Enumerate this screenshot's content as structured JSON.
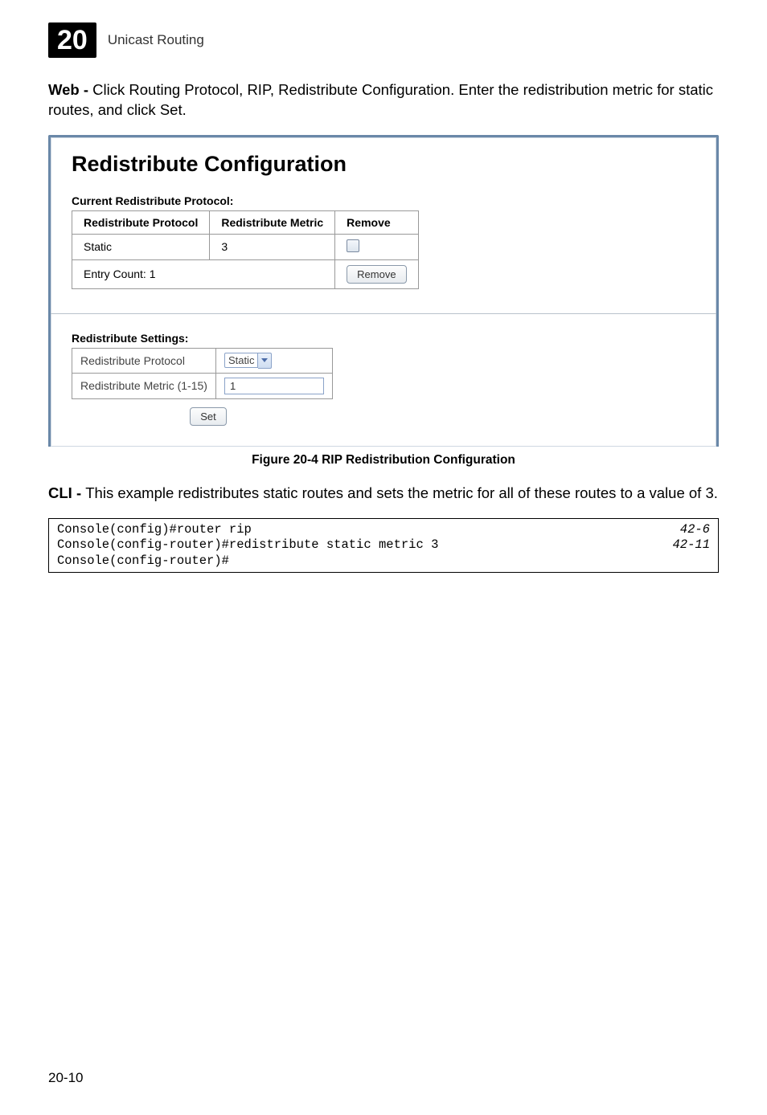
{
  "header": {
    "chapter_number": "20",
    "chapter_title": "Unicast Routing"
  },
  "intro": {
    "lead": "Web - ",
    "text": "Click Routing Protocol, RIP, Redistribute Configuration. Enter the redistribution metric for static routes, and click Set."
  },
  "panel": {
    "title": "Redistribute Configuration",
    "current_protocol_label": "Current Redistribute Protocol:",
    "table": {
      "headers": [
        "Redistribute Protocol",
        "Redistribute Metric",
        "Remove"
      ],
      "rows": [
        {
          "protocol": "Static",
          "metric": "3",
          "remove_checked": false
        }
      ],
      "entry_count_label": "Entry Count: 1",
      "remove_button": "Remove"
    },
    "settings": {
      "heading": "Redistribute Settings:",
      "rows": [
        {
          "label": "Redistribute Protocol",
          "value": "Static",
          "type": "select"
        },
        {
          "label": "Redistribute Metric (1-15)",
          "value": "1",
          "type": "text"
        }
      ],
      "set_button": "Set"
    }
  },
  "figure_caption": "Figure 20-4   RIP Redistribution Configuration",
  "cli": {
    "lead": "CLI - ",
    "text": "This example redistributes static routes and sets the metric for all of these routes to a value of 3.",
    "lines": [
      {
        "cmd": "Console(config)#router rip",
        "ref": "42-6"
      },
      {
        "cmd": "Console(config-router)#redistribute static metric 3",
        "ref": "42-11"
      },
      {
        "cmd": "Console(config-router)#",
        "ref": ""
      }
    ]
  },
  "page_number": "20-10",
  "chart_data": {
    "type": "table",
    "title": "Current Redistribute Protocol",
    "columns": [
      "Redistribute Protocol",
      "Redistribute Metric",
      "Remove"
    ],
    "rows": [
      [
        "Static",
        3,
        false
      ]
    ],
    "entry_count": 1
  }
}
